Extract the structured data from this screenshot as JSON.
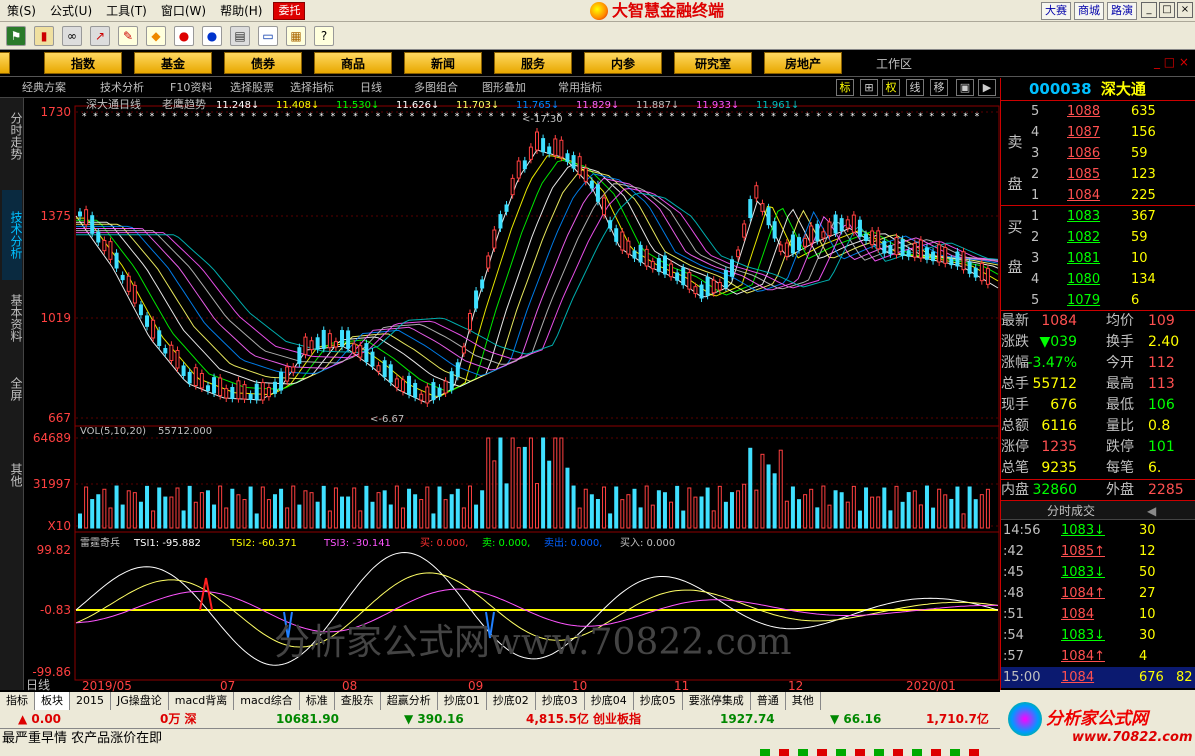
{
  "menu": {
    "items": [
      "策(S)",
      "公式(U)",
      "工具(T)",
      "窗口(W)",
      "帮助(H)"
    ],
    "weituo": "委托",
    "title": "大智慧金融终端",
    "quicklinks": [
      "大赛",
      "商城",
      "路演"
    ]
  },
  "nav": [
    "股",
    "指数",
    "基金",
    "债券",
    "商品",
    "新闻",
    "服务",
    "内参",
    "研究室",
    "房地产"
  ],
  "workzone": "工作区",
  "analysis_bar": {
    "items": [
      "经典方案",
      "技术分析",
      "F10资料",
      "选择股票",
      "选择指标",
      "日线",
      "多图组合",
      "图形叠加",
      "常用指标"
    ],
    "right_buttons": [
      "标",
      "线",
      "权",
      "线",
      "移"
    ]
  },
  "vtabs": [
    "分时走势",
    "技术分析",
    "基本资料",
    "全屏",
    "其他"
  ],
  "kline_panel": {
    "title": "深大通日线",
    "indicator": "老鹰趋势",
    "ma_values": [
      "11.248",
      "11.408",
      "11.530",
      "11.626",
      "11.703",
      "11.765",
      "11.829",
      "11.887",
      "11.933",
      "11.961"
    ],
    "ma_colors": [
      "#ffffff",
      "#ffff00",
      "#00ff00",
      "#ffffff",
      "#ffff66",
      "#0088ff",
      "#ff66ff",
      "#c0c0c0",
      "#ff55ff",
      "#00c0c0"
    ],
    "y_ticks": [
      "1730",
      "1375",
      "1019",
      "667"
    ],
    "high_label": "17.30",
    "low_label": "6.67"
  },
  "volume_panel": {
    "title": "VOL(5,10,20)",
    "value": "55712.000",
    "y_ticks": [
      "64689",
      "31997",
      "X10"
    ]
  },
  "osc_panel": {
    "title": "雷霆奇兵",
    "tsi1": "TSI1: -95.882",
    "tsi2": "TSI2: -60.371",
    "tsi3": "TSI3: -30.141",
    "buy": "买: 0.000,",
    "sell": "卖: 0.000,",
    "sellout": "卖出: 0.000,",
    "buyin": "买入: 0.000",
    "y_ticks": [
      "99.82",
      "-0.83",
      "-99.86"
    ],
    "watermark": "分析家公式网www.70822.com"
  },
  "x_axis": {
    "mode": "日线",
    "labels": [
      "2019/05",
      "07",
      "08",
      "09",
      "10",
      "11",
      "12",
      "2020/01"
    ]
  },
  "stock": {
    "code": "000038",
    "name": "深大通"
  },
  "orderbook": {
    "sell_label": [
      "卖",
      "盘"
    ],
    "buy_label": [
      "买",
      "盘"
    ],
    "asks": [
      {
        "level": "5",
        "price": "1088",
        "vol": "635"
      },
      {
        "level": "4",
        "price": "1087",
        "vol": "156"
      },
      {
        "level": "3",
        "price": "1086",
        "vol": "59"
      },
      {
        "level": "2",
        "price": "1085",
        "vol": "123"
      },
      {
        "level": "1",
        "price": "1084",
        "vol": "225"
      }
    ],
    "bids": [
      {
        "level": "1",
        "price": "1083",
        "vol": "367"
      },
      {
        "level": "2",
        "price": "1082",
        "vol": "59"
      },
      {
        "level": "3",
        "price": "1081",
        "vol": "10"
      },
      {
        "level": "4",
        "price": "1080",
        "vol": "134"
      },
      {
        "level": "5",
        "price": "1079",
        "vol": "6"
      }
    ]
  },
  "quote": [
    {
      "l": "最新",
      "lv": "1084",
      "lc": "#ff5050",
      "r": "均价",
      "rv": "109",
      "rc": "#ff5050"
    },
    {
      "l": "涨跌",
      "lv": "▼039",
      "lc": "#00ff00",
      "r": "换手",
      "rv": "2.40",
      "rc": "#ffff00"
    },
    {
      "l": "涨幅",
      "lv": "-3.47%",
      "lc": "#00ff00",
      "r": "今开",
      "rv": "112",
      "rc": "#ff5050"
    },
    {
      "l": "总手",
      "lv": "55712",
      "lc": "#ffff00",
      "r": "最高",
      "rv": "113",
      "rc": "#ff5050"
    },
    {
      "l": "现手",
      "lv": "676",
      "lc": "#ffff00",
      "r": "最低",
      "rv": "106",
      "rc": "#00ff00"
    },
    {
      "l": "总额",
      "lv": "6116",
      "lc": "#ffff00",
      "r": "量比",
      "rv": "0.8",
      "rc": "#ffff00"
    },
    {
      "l": "涨停",
      "lv": "1235",
      "lc": "#ff5050",
      "r": "跌停",
      "rv": "101",
      "rc": "#00ff00"
    },
    {
      "l": "总笔",
      "lv": "9235",
      "lc": "#ffff00",
      "r": "每笔",
      "rv": "6.",
      "rc": "#ffff00"
    },
    {
      "l": "内盘",
      "lv": "32860",
      "lc": "#00ff00",
      "r": "外盘",
      "rv": "2285",
      "rc": "#ff5050"
    }
  ],
  "ticks_header": "分时成交",
  "ticks": [
    {
      "time": "14:56",
      "price": "1083",
      "pc": "#00ff00",
      "arrow": "↓",
      "ac": "#00ff00",
      "vol": "30"
    },
    {
      "time": ":42",
      "price": "1085",
      "pc": "#ff5050",
      "arrow": "↑",
      "ac": "#ff3030",
      "vol": "12"
    },
    {
      "time": ":45",
      "price": "1083",
      "pc": "#00ff00",
      "arrow": "↓",
      "ac": "#00ff00",
      "vol": "50"
    },
    {
      "time": ":48",
      "price": "1084",
      "pc": "#ff5050",
      "arrow": "↑",
      "ac": "#ff3030",
      "vol": "27"
    },
    {
      "time": ":51",
      "price": "1084",
      "pc": "#ff5050",
      "arrow": "",
      "ac": "#ff3030",
      "vol": "10"
    },
    {
      "time": ":54",
      "price": "1083",
      "pc": "#00ff00",
      "arrow": "↓",
      "ac": "#00ff00",
      "vol": "30"
    },
    {
      "time": ":57",
      "price": "1084",
      "pc": "#ff5050",
      "arrow": "↑",
      "ac": "#ff3030",
      "vol": "4"
    },
    {
      "time": "15:00",
      "price": "1084",
      "pc": "#ff5050",
      "arrow": "",
      "ac": "#ff3030",
      "vol": "676"
    }
  ],
  "last_tick_extra": "82",
  "bottom_tabs": [
    "指标",
    "板块",
    "2015",
    "JG操盘论",
    "macd背离",
    "macd综合",
    "标准",
    "查股东",
    "超赢分析",
    "抄底01",
    "抄底02",
    "抄底03",
    "抄底04",
    "抄底05",
    "要涨停集成",
    "普通",
    "其他"
  ],
  "index_ticker": [
    {
      "text": "▲ 0.00",
      "color": "#d00"
    },
    {
      "text": "0万 深",
      "color": "#d00"
    },
    {
      "text": "10681.90",
      "color": "#080"
    },
    {
      "text": "▼ 390.16",
      "color": "#080"
    },
    {
      "text": "4,815.5亿 创业板指",
      "color": "#d00"
    },
    {
      "text": "1927.74",
      "color": "#080"
    },
    {
      "text": "▼ 66.16",
      "color": "#080"
    },
    {
      "text": "1,710.7亿",
      "color": "#d00"
    }
  ],
  "status_text": "最严重早情 农产品涨价在即",
  "corner": {
    "title": "分析家公式网",
    "url": "www.70822.com"
  }
}
